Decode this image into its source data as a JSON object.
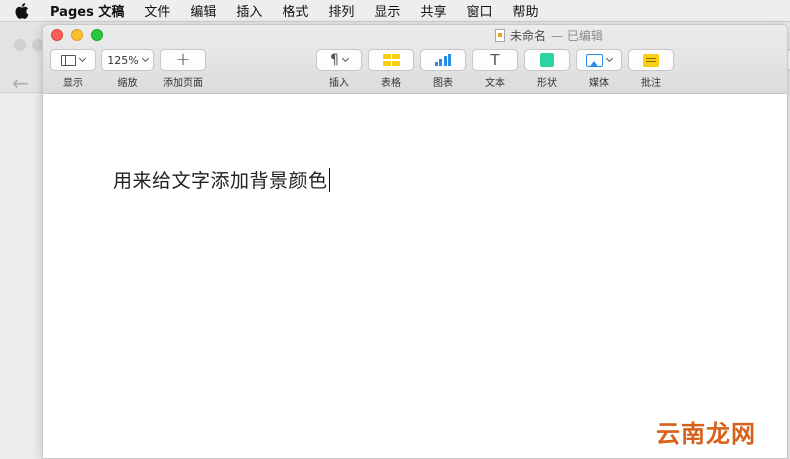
{
  "menubar": {
    "app_name": "Pages 文稿",
    "items": [
      "文件",
      "编辑",
      "插入",
      "格式",
      "排列",
      "显示",
      "共享",
      "窗口",
      "帮助"
    ]
  },
  "window": {
    "doc_title": "未命名",
    "edited": "— 已编辑"
  },
  "toolbar": {
    "view_label": "显示",
    "zoom_value": "125%",
    "zoom_label": "缩放",
    "add_page_label": "添加页面",
    "insert_label": "插入",
    "table_label": "表格",
    "chart_label": "图表",
    "text_label": "文本",
    "shape_label": "形状",
    "media_label": "媒体",
    "comment_label": "批注"
  },
  "document": {
    "body_text": "用来给文字添加背景颜色"
  },
  "watermark": "云南龙网",
  "colors": {
    "close": "#fc5f57",
    "minimize": "#fdbc2e",
    "maximize": "#28c840",
    "table_icon": "#f7cf15",
    "chart_icon": "#2a8ee6",
    "shape_icon": "#2ed3a4",
    "watermark": "#d8611b"
  }
}
